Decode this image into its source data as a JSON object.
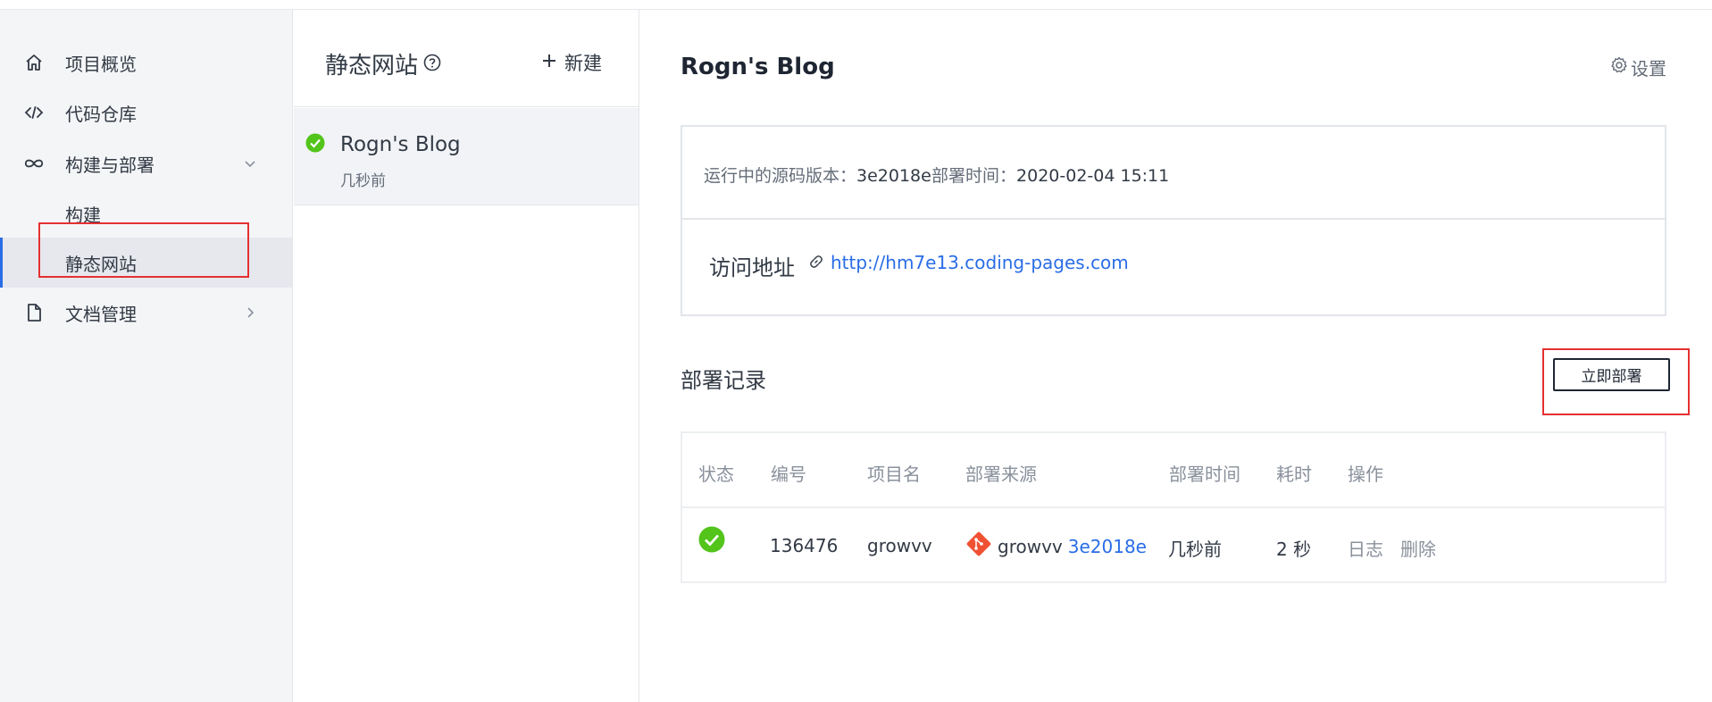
{
  "sidebar": {
    "items": [
      {
        "label": "项目概览",
        "icon": "home-icon"
      },
      {
        "label": "代码仓库",
        "icon": "code-icon"
      },
      {
        "label": "构建与部署",
        "icon": "infinity-icon"
      },
      {
        "label": "构建"
      },
      {
        "label": "静态网站"
      },
      {
        "label": "文档管理",
        "icon": "document-icon"
      }
    ]
  },
  "sites": {
    "title": "静态网站",
    "new_label": "新建",
    "items": [
      {
        "name": "Rogn's Blog",
        "time": "几秒前"
      }
    ]
  },
  "main": {
    "title": "Rogn's Blog",
    "settings_label": "设置",
    "info": {
      "version_label": "运行中的源码版本：",
      "version_value": "3e2018e",
      "deploy_time_label": "部署时间：",
      "deploy_time_value": "2020-02-04 15:11",
      "address_label": "访问地址",
      "address_url": "http://hm7e13.coding-pages.com"
    },
    "records": {
      "title": "部署记录",
      "deploy_button": "立即部署",
      "columns": [
        "状态",
        "编号",
        "项目名",
        "部署来源",
        "部署时间",
        "耗时",
        "操作"
      ],
      "rows": [
        {
          "id": "136476",
          "project": "growvv",
          "source_repo": "growvv",
          "source_commit": "3e2018e",
          "time": "几秒前",
          "duration": "2 秒",
          "action_log": "日志",
          "action_delete": "删除"
        }
      ]
    }
  },
  "colors": {
    "accent": "#2a6de6",
    "success": "#52c41a",
    "highlight_border": "#e53030",
    "git": "#f05133"
  }
}
